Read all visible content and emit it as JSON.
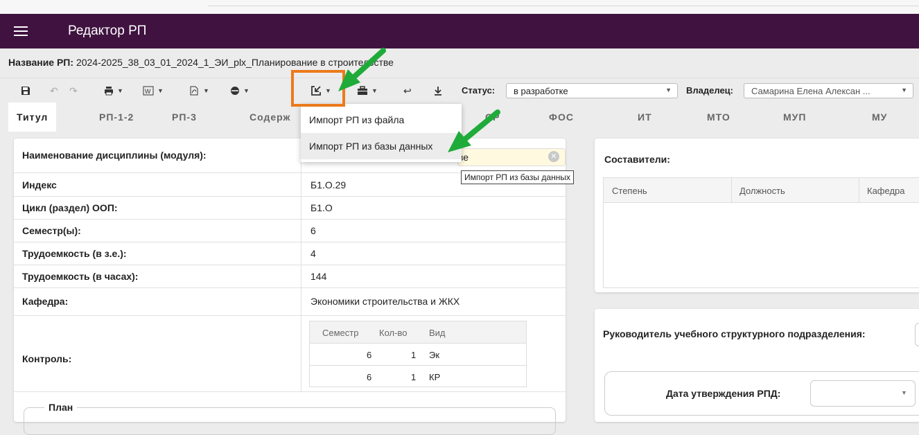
{
  "app": {
    "title": "Редактор РП"
  },
  "rp_name": {
    "label": "Название РП:",
    "value": "2024-2025_38_03_01_2024_1_ЭИ_plx_Планирование в строительстве"
  },
  "toolbar": {
    "status_label": "Статус:",
    "status_value": "в разработке",
    "owner_label": "Владелец:",
    "owner_value": "Самарина Елена Алексан ..."
  },
  "tabs": [
    "Титул",
    "РП-1-2",
    "РП-3",
    "Содерж",
    "СР",
    "ФОС",
    "ИТ",
    "МТО",
    "МУП",
    "МУ"
  ],
  "import_menu": {
    "items": [
      "Импорт РП из файла",
      "Импорт РП из базы данных"
    ],
    "tooltip": "Импорт РП из базы данных"
  },
  "discipline": {
    "name_label": "Наименование дисциплины (модуля):",
    "name_value_tail": "ве",
    "rows": [
      {
        "label": "Индекс",
        "value": "Б1.О.29"
      },
      {
        "label": "Цикл (раздел) ООП:",
        "value": "Б1.О"
      },
      {
        "label": "Семестр(ы):",
        "value": "6"
      },
      {
        "label": "Трудоемкость (в з.е.):",
        "value": "4"
      },
      {
        "label": "Трудоемкость (в часах):",
        "value": "144"
      },
      {
        "label": "Кафедра:",
        "value": "Экономики строительства и ЖКХ"
      }
    ],
    "control_label": "Контроль:",
    "control_table": {
      "headers": [
        "Семестр",
        "Кол-во",
        "Вид"
      ],
      "rows": [
        [
          "6",
          "1",
          "Эк"
        ],
        [
          "6",
          "1",
          "КР"
        ]
      ]
    },
    "plan_label": "План"
  },
  "authors": {
    "title": "Составители:",
    "headers": [
      "Степень",
      "Должность",
      "Кафедра"
    ]
  },
  "head": {
    "title": "Руководитель учебного структурного подразделения:",
    "date_label": "Дата утверждения РПД:"
  },
  "colors": {
    "appbar": "#3f1240",
    "highlight": "#ec7a1c",
    "arrow": "#1fab3a"
  }
}
